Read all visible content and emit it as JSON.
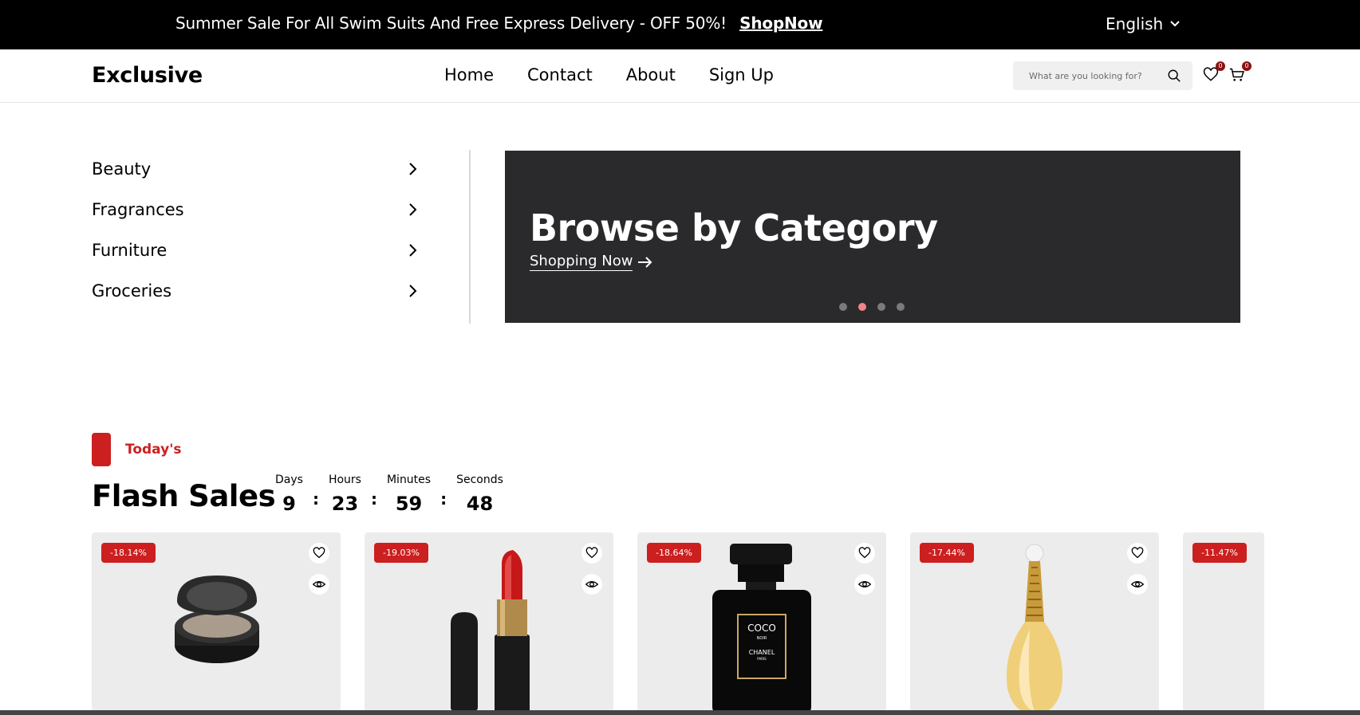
{
  "topbar": {
    "promo_text": "Summer Sale For All Swim Suits And Free Express Delivery - OFF 50%!",
    "promo_link": "ShopNow",
    "language": "English"
  },
  "header": {
    "logo": "Exclusive",
    "nav": [
      "Home",
      "Contact",
      "About",
      "Sign Up"
    ],
    "search_placeholder": "What are you looking for?",
    "wishlist_count": "0",
    "cart_count": "0"
  },
  "categories": [
    "Beauty",
    "Fragrances",
    "Furniture",
    "Groceries"
  ],
  "hero": {
    "title": "Browse by Category",
    "cta": "Shopping Now",
    "slides": 4,
    "active_slide": 2
  },
  "flash": {
    "tag": "Today's",
    "title": "Flash Sales",
    "timer": {
      "days_label": "Days",
      "days": "9",
      "hours_label": "Hours",
      "hours": "23",
      "minutes_label": "Minutes",
      "minutes": "59",
      "seconds_label": "Seconds",
      "seconds": "48"
    }
  },
  "products": [
    {
      "discount": "-18.14%",
      "image": "compact-powder"
    },
    {
      "discount": "-19.03%",
      "image": "red-lipstick"
    },
    {
      "discount": "-18.64%",
      "image": "perfume-bottle-coco-noir"
    },
    {
      "discount": "-17.44%",
      "image": "perfume-bottle-gold"
    },
    {
      "discount": "-11.47%",
      "image": "partial-product"
    }
  ],
  "product_label": {
    "brand": "COCO",
    "sub": "NOIR",
    "maker": "CHANEL",
    "place": "PARIS"
  },
  "colors": {
    "accent": "#cc1f1f",
    "hero_bg": "#2a2a2c",
    "card_bg": "#ececec",
    "active_dot": "#f28585"
  }
}
